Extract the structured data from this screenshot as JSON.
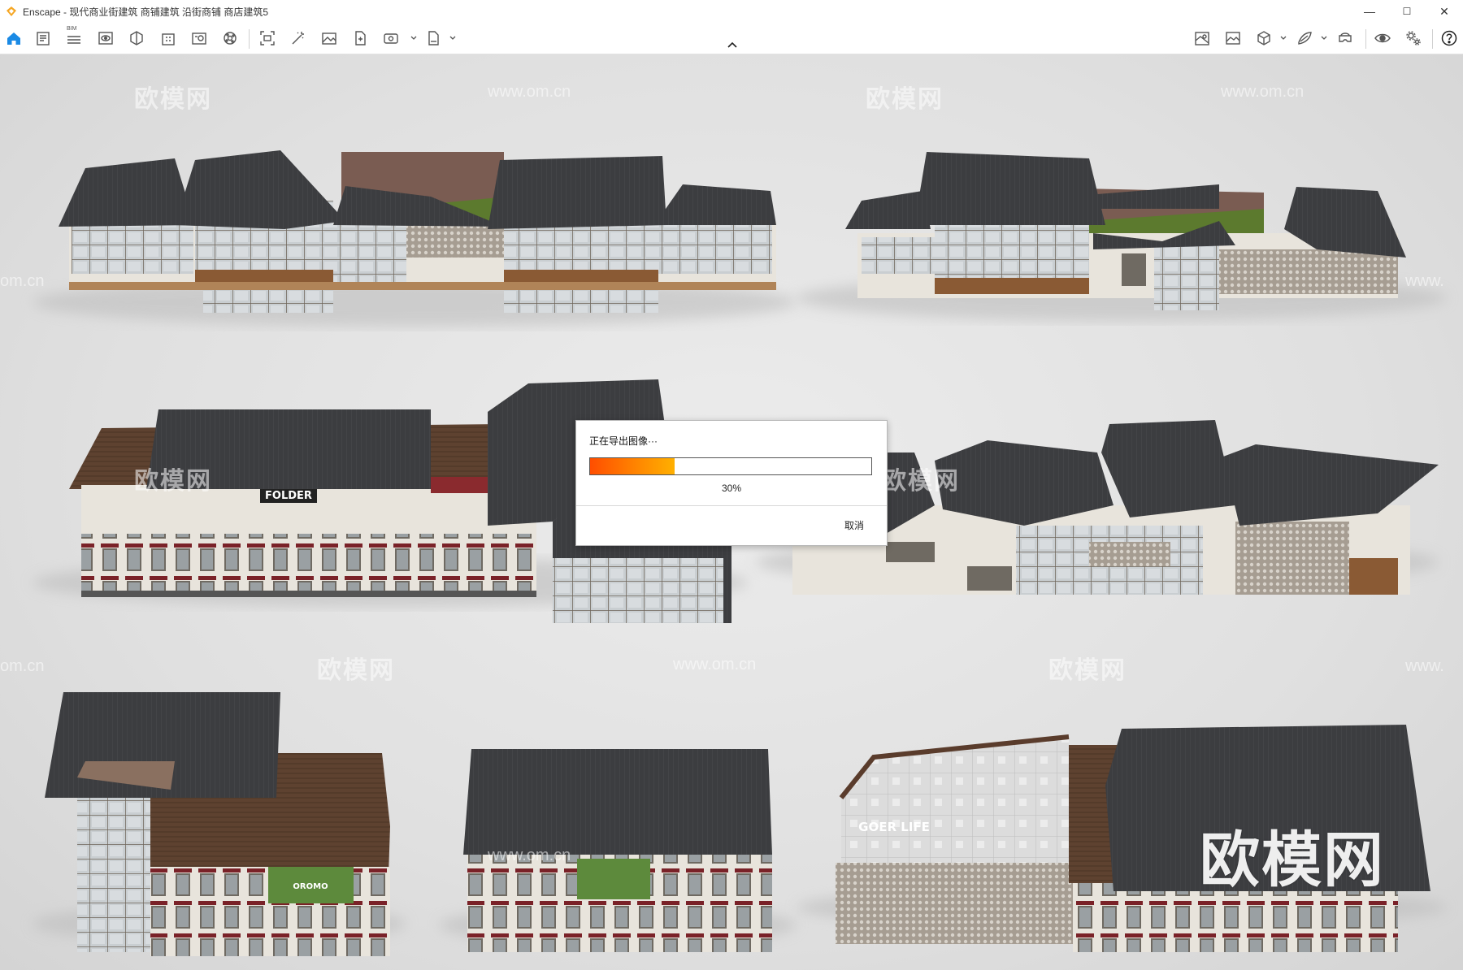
{
  "window": {
    "title": "Enscape - 现代商业街建筑 商铺建筑 沿街商铺 商店建筑5",
    "accent_color": "#f5a623",
    "controls": {
      "minimize": "—",
      "maximize": "☐",
      "close": "✕"
    }
  },
  "toolbar": {
    "left_icons": [
      "home-icon",
      "project-info-icon",
      "bim-icon",
      "view-icon",
      "material-icon",
      "building-icon",
      "asset-library-icon",
      "atmosphere-icon",
      "screenshot-icon",
      "magic-wand-icon",
      "image-icon",
      "batch-render-icon",
      "panorama-icon",
      "export-icon"
    ],
    "bim_label": "BIM",
    "right_icons": [
      "map-icon",
      "visual-settings-icon",
      "cube-icon",
      "layers-icon",
      "vr-headset-icon",
      "eye-icon",
      "settings-icon",
      "help-icon"
    ],
    "highlight_color": "#1a8ae5"
  },
  "watermarks": {
    "brand": "欧模网",
    "url": "www.om.cn",
    "url_fragment": "om.cn",
    "url_prefix": "www."
  },
  "dialog": {
    "title": "正在导出图像···",
    "progress_percent": 30,
    "progress_label": "30%",
    "cancel_label": "取消"
  },
  "viewport": {
    "signs": [
      "FOLDER",
      "GOER LIFE",
      "OROMO"
    ],
    "roof_color": "#3c3d40",
    "facade_color": "#e8e4dc",
    "wood_color": "#6b4a33",
    "green_roof_color": "#5c7a2e"
  }
}
